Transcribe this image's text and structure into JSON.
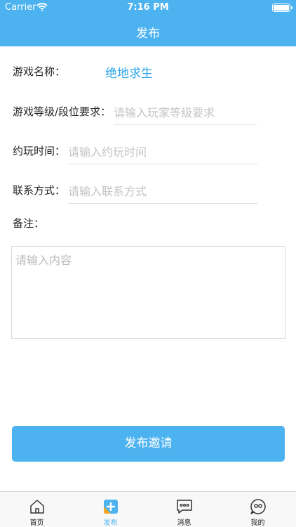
{
  "status_bar": {
    "carrier": "Carrier",
    "time": "7:16 PM"
  },
  "nav": {
    "title": "发布"
  },
  "form": {
    "game_name_label": "游戏名称：",
    "game_name_value": "绝地求生",
    "rank_label": "游戏等级/段位要求：",
    "rank_placeholder": "请输入玩家等级要求",
    "time_label": "约玩时间：",
    "time_placeholder": "请输入约玩时间",
    "contact_label": "联系方式：",
    "contact_placeholder": "请输入联系方式",
    "remark_label": "备注：",
    "remark_placeholder": "请输入内容"
  },
  "submit_label": "发布邀请",
  "tabs": [
    {
      "label": "首页",
      "icon": "home-icon"
    },
    {
      "label": "发布",
      "icon": "publish-plus-icon",
      "active": true
    },
    {
      "label": "消息",
      "icon": "message-icon"
    },
    {
      "label": "我的",
      "icon": "profile-face-icon"
    }
  ],
  "colors": {
    "primary": "#4db3f0",
    "value_text": "#29a5e8",
    "placeholder": "#c4c4c8"
  }
}
